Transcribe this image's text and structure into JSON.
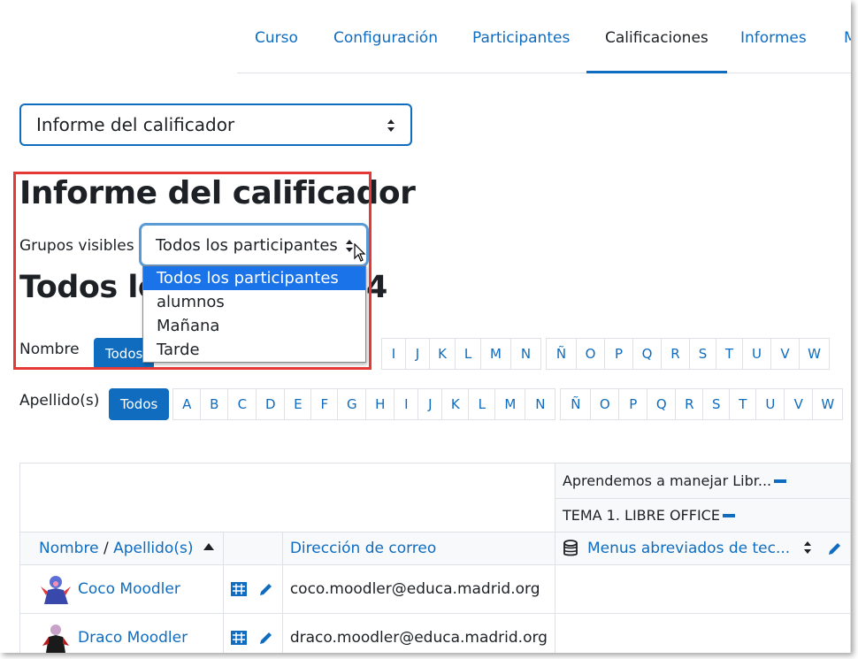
{
  "nav": {
    "tabs": [
      {
        "label": "Curso"
      },
      {
        "label": "Configuración"
      },
      {
        "label": "Participantes"
      },
      {
        "label": "Calificaciones"
      },
      {
        "label": "Informes"
      },
      {
        "label": "M"
      }
    ],
    "active_tab": "Calificaciones"
  },
  "report_select": {
    "value": "Informe del calificador"
  },
  "page_title": "Informe del calificador",
  "groups": {
    "label": "Grupos visibles",
    "selected": "Todos los participantes",
    "options": [
      "Todos los participantes",
      "alumnos",
      "Mañana",
      "Tarde"
    ]
  },
  "subtitle": {
    "left": "Todos los",
    "right": "4"
  },
  "filters": {
    "first_name": {
      "label": "Nombre",
      "all": "Todos",
      "letters": [
        "I",
        "J",
        "K",
        "L",
        "M",
        "N",
        "Ñ",
        "O",
        "P",
        "Q",
        "R",
        "S",
        "T",
        "U",
        "V",
        "W"
      ]
    },
    "last_name": {
      "label": "Apellido(s)",
      "all": "Todos",
      "letters": [
        "A",
        "B",
        "C",
        "D",
        "E",
        "F",
        "G",
        "H",
        "I",
        "J",
        "K",
        "L",
        "M",
        "N",
        "Ñ",
        "O",
        "P",
        "Q",
        "R",
        "S",
        "T",
        "U",
        "V",
        "W"
      ]
    }
  },
  "table": {
    "category": "Aprendemos a manejar Libr...",
    "subcategory": "TEMA 1. LIBRE OFFICE",
    "col_name_first": "Nombre",
    "col_name_sep": " / ",
    "col_name_last": "Apellido(s)",
    "col_email": "Dirección de correo",
    "col_item": "Menus abreviados de tec...",
    "rows": [
      {
        "name": "Coco Moodler",
        "email": "coco.moodler@educa.madrid.org"
      },
      {
        "name": "Draco Moodler",
        "email": "draco.moodler@educa.madrid.org"
      }
    ]
  },
  "colors": {
    "accent": "#0f6cbf",
    "highlight_box": "#e53935",
    "option_selected": "#1a73e8"
  }
}
